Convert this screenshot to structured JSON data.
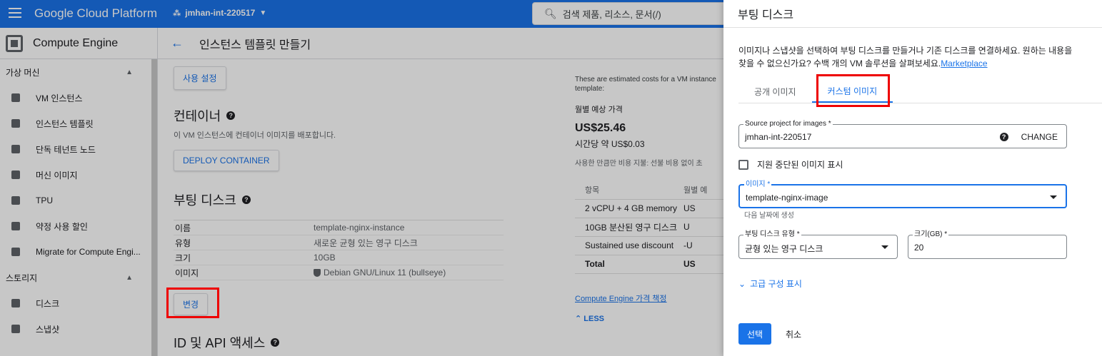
{
  "topbar": {
    "brand": "Google Cloud Platform",
    "project": "jmhan-int-220517",
    "search_text": "검색  제품, 리소스, 문서(/)"
  },
  "nav": {
    "title": "Compute Engine",
    "sections": [
      {
        "label": "가상 머신",
        "items": [
          {
            "label": "VM 인스턴스",
            "icon": "vm-instance-icon"
          },
          {
            "label": "인스턴스 템플릿",
            "icon": "template-icon"
          },
          {
            "label": "단독 테넌트 노드",
            "icon": "sole-tenant-icon"
          },
          {
            "label": "머신 이미지",
            "icon": "machine-image-icon"
          },
          {
            "label": "TPU",
            "icon": "tpu-icon"
          },
          {
            "label": "약정 사용 할인",
            "icon": "discount-icon"
          },
          {
            "label": "Migrate for Compute Engi...",
            "icon": "search-icon"
          }
        ]
      },
      {
        "label": "스토리지",
        "items": [
          {
            "label": "디스크",
            "icon": "disk-icon"
          },
          {
            "label": "스냅샷",
            "icon": "snapshot-icon"
          }
        ]
      }
    ]
  },
  "main": {
    "page_title": "인스턴스 템플릿 만들기",
    "custom_settings_button": "사용 설정",
    "container": {
      "heading": "컨테이너",
      "description": "이 VM 인스턴스에 컨테이너 이미지를 배포합니다.",
      "deploy_button": "DEPLOY CONTAINER"
    },
    "boot_disk": {
      "heading": "부팅 디스크",
      "rows": [
        {
          "key": "이름",
          "value": "template-nginx-instance"
        },
        {
          "key": "유형",
          "value": "새로운 균형 있는 영구 디스크"
        },
        {
          "key": "크기",
          "value": "10GB"
        },
        {
          "key": "이미지",
          "value": "Debian GNU/Linux 11 (bullseye)"
        }
      ],
      "change_button": "변경"
    },
    "api_heading": "ID 및 API 액세스"
  },
  "cost": {
    "note": "These are estimated costs for a VM instance template:",
    "monthly_label": "월별 예상 가격",
    "monthly_value": "US$25.46",
    "hourly": "시간당 약 US$0.03",
    "desc": "사용한 만큼만 비용 지불: 선불 비용 없이 초",
    "table_header": [
      "항목",
      "월별 예"
    ],
    "rows": [
      [
        "2 vCPU + 4 GB memory",
        "US"
      ],
      [
        "10GB 분산된 영구 디스크",
        "U"
      ],
      [
        "Sustained use discount",
        "-U"
      ]
    ],
    "total": [
      "Total",
      "US"
    ],
    "pricing_link": "Compute Engine 가격 책정",
    "less": "LESS"
  },
  "panel": {
    "title": "부팅 디스크",
    "description": "이미지나 스냅샷을 선택하여 부팅 디스크를 만들거나 기존 디스크를 연결하세요. 원하는 내용을 찾을 수 없으신가요? 수백 개의 VM 솔루션을 살펴보세요.",
    "marketplace": "Marketplace",
    "tabs": [
      "공개 이미지",
      "커스텀 이미지"
    ],
    "source_project_label": "Source project for images *",
    "source_project_value": "jmhan-int-220517",
    "change_label": "CHANGE",
    "deprecated_label": "지원 중단된 이미지 표시",
    "image_label": "이미지 *",
    "image_value": "template-nginx-image",
    "image_hint": "다음 날짜에 생성",
    "disk_type_label": "부팅 디스크 유형 *",
    "disk_type_value": "균형 있는 영구 디스크",
    "size_label": "크기(GB) *",
    "size_value": "20",
    "advanced": "고급 구성 표시",
    "select_button": "선택",
    "cancel_button": "취소"
  },
  "colors": {
    "accent": "#1a73e8",
    "highlight": "#ee0000"
  }
}
